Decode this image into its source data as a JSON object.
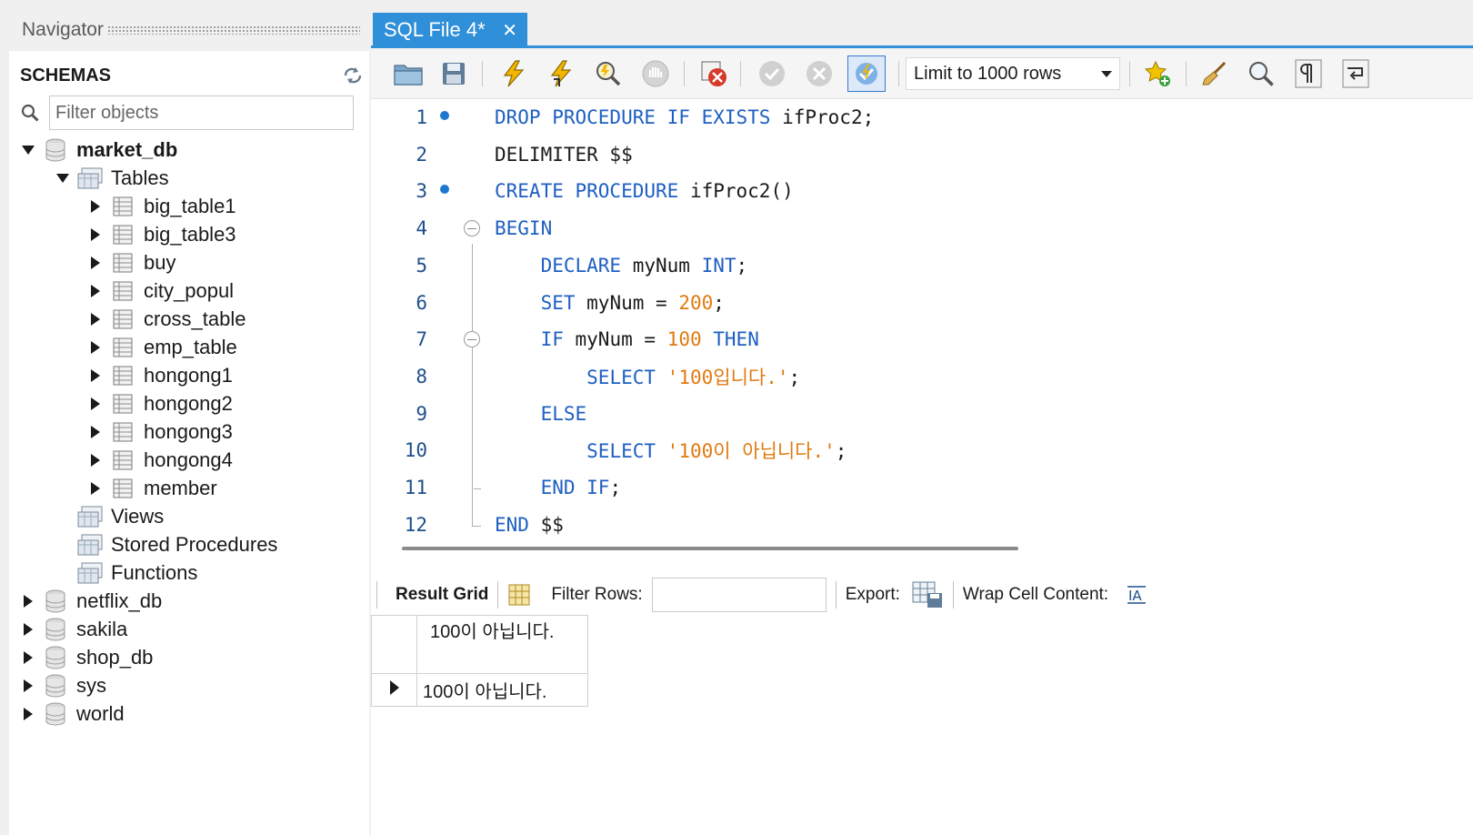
{
  "navigator": {
    "title": "Navigator",
    "schemas_title": "SCHEMAS",
    "filter_placeholder": "Filter objects",
    "tree": {
      "market_db": "market_db",
      "tables": "Tables",
      "table_items": [
        "big_table1",
        "big_table3",
        "buy",
        "city_popul",
        "cross_table",
        "emp_table",
        "hongong1",
        "hongong2",
        "hongong3",
        "hongong4",
        "member"
      ],
      "views": "Views",
      "stored_procedures": "Stored Procedures",
      "functions": "Functions",
      "other_schemas": [
        "netflix_db",
        "sakila",
        "shop_db",
        "sys",
        "world"
      ]
    }
  },
  "editor": {
    "tab_label": "SQL File 4*",
    "limit_label": "Limit to 1000 rows",
    "lines": [
      {
        "n": "1",
        "tokens": [
          [
            "kw",
            "DROP PROCEDURE IF EXISTS"
          ],
          [
            "t",
            " ifProc2;"
          ]
        ]
      },
      {
        "n": "2",
        "tokens": [
          [
            "t",
            "DELIMITER $$"
          ]
        ]
      },
      {
        "n": "3",
        "tokens": [
          [
            "kw",
            "CREATE PROCEDURE"
          ],
          [
            "t",
            " ifProc2()"
          ]
        ]
      },
      {
        "n": "4",
        "tokens": [
          [
            "kw",
            "BEGIN"
          ]
        ]
      },
      {
        "n": "5",
        "tokens": [
          [
            "t",
            "    "
          ],
          [
            "kw",
            "DECLARE"
          ],
          [
            "t",
            " myNum "
          ],
          [
            "kw",
            "INT"
          ],
          [
            "t",
            ";"
          ]
        ]
      },
      {
        "n": "6",
        "tokens": [
          [
            "t",
            "    "
          ],
          [
            "kw",
            "SET"
          ],
          [
            "t",
            " myNum = "
          ],
          [
            "num",
            "200"
          ],
          [
            "t",
            ";"
          ]
        ]
      },
      {
        "n": "7",
        "tokens": [
          [
            "t",
            "    "
          ],
          [
            "kw",
            "IF"
          ],
          [
            "t",
            " myNum = "
          ],
          [
            "num",
            "100"
          ],
          [
            "t",
            " "
          ],
          [
            "kw",
            "THEN"
          ]
        ]
      },
      {
        "n": "8",
        "tokens": [
          [
            "t",
            "        "
          ],
          [
            "kw",
            "SELECT"
          ],
          [
            "t",
            " "
          ],
          [
            "str",
            "'100입니다.'"
          ],
          [
            "t",
            ";"
          ]
        ]
      },
      {
        "n": "9",
        "tokens": [
          [
            "t",
            "    "
          ],
          [
            "kw",
            "ELSE"
          ]
        ]
      },
      {
        "n": "10",
        "tokens": [
          [
            "t",
            "        "
          ],
          [
            "kw",
            "SELECT"
          ],
          [
            "t",
            " "
          ],
          [
            "str",
            "'100이 아닙니다.'"
          ],
          [
            "t",
            ";"
          ]
        ]
      },
      {
        "n": "11",
        "tokens": [
          [
            "t",
            "    "
          ],
          [
            "kw",
            "END IF"
          ],
          [
            "t",
            ";"
          ]
        ]
      },
      {
        "n": "12",
        "tokens": [
          [
            "kw",
            "END"
          ],
          [
            "t",
            " $$"
          ]
        ]
      }
    ]
  },
  "results": {
    "result_grid_label": "Result Grid",
    "filter_rows_label": "Filter Rows:",
    "export_label": "Export:",
    "wrap_label": "Wrap Cell Content:",
    "column_header": "100이 아닙니다.",
    "row_value": "100이 아닙니다."
  },
  "colors": {
    "accent": "#2f8fd8",
    "keyword": "#1e5fc2",
    "literal": "#e07a10"
  }
}
